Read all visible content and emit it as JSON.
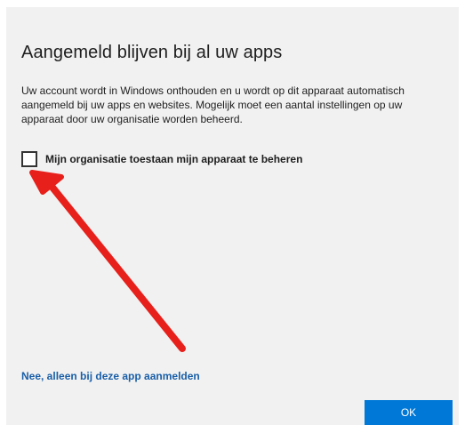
{
  "dialog": {
    "title": "Aangemeld blijven bij al uw apps",
    "body": "Uw account wordt in Windows onthouden en u wordt op dit apparaat automatisch aangemeld bij uw apps en websites. Mogelijk moet een aantal instellingen op uw apparaat door uw organisatie worden beheerd.",
    "checkbox_label": "Mijn organisatie toestaan mijn apparaat te beheren",
    "checkbox_checked": false,
    "link_text": "Nee, alleen bij deze app aanmelden",
    "ok_label": "OK"
  },
  "colors": {
    "background": "#f1f1f1",
    "accent": "#0078d7",
    "link": "#1a5fa8",
    "annotation_arrow": "#e8201b"
  },
  "annotation": {
    "icon": "red-arrow-icon"
  }
}
